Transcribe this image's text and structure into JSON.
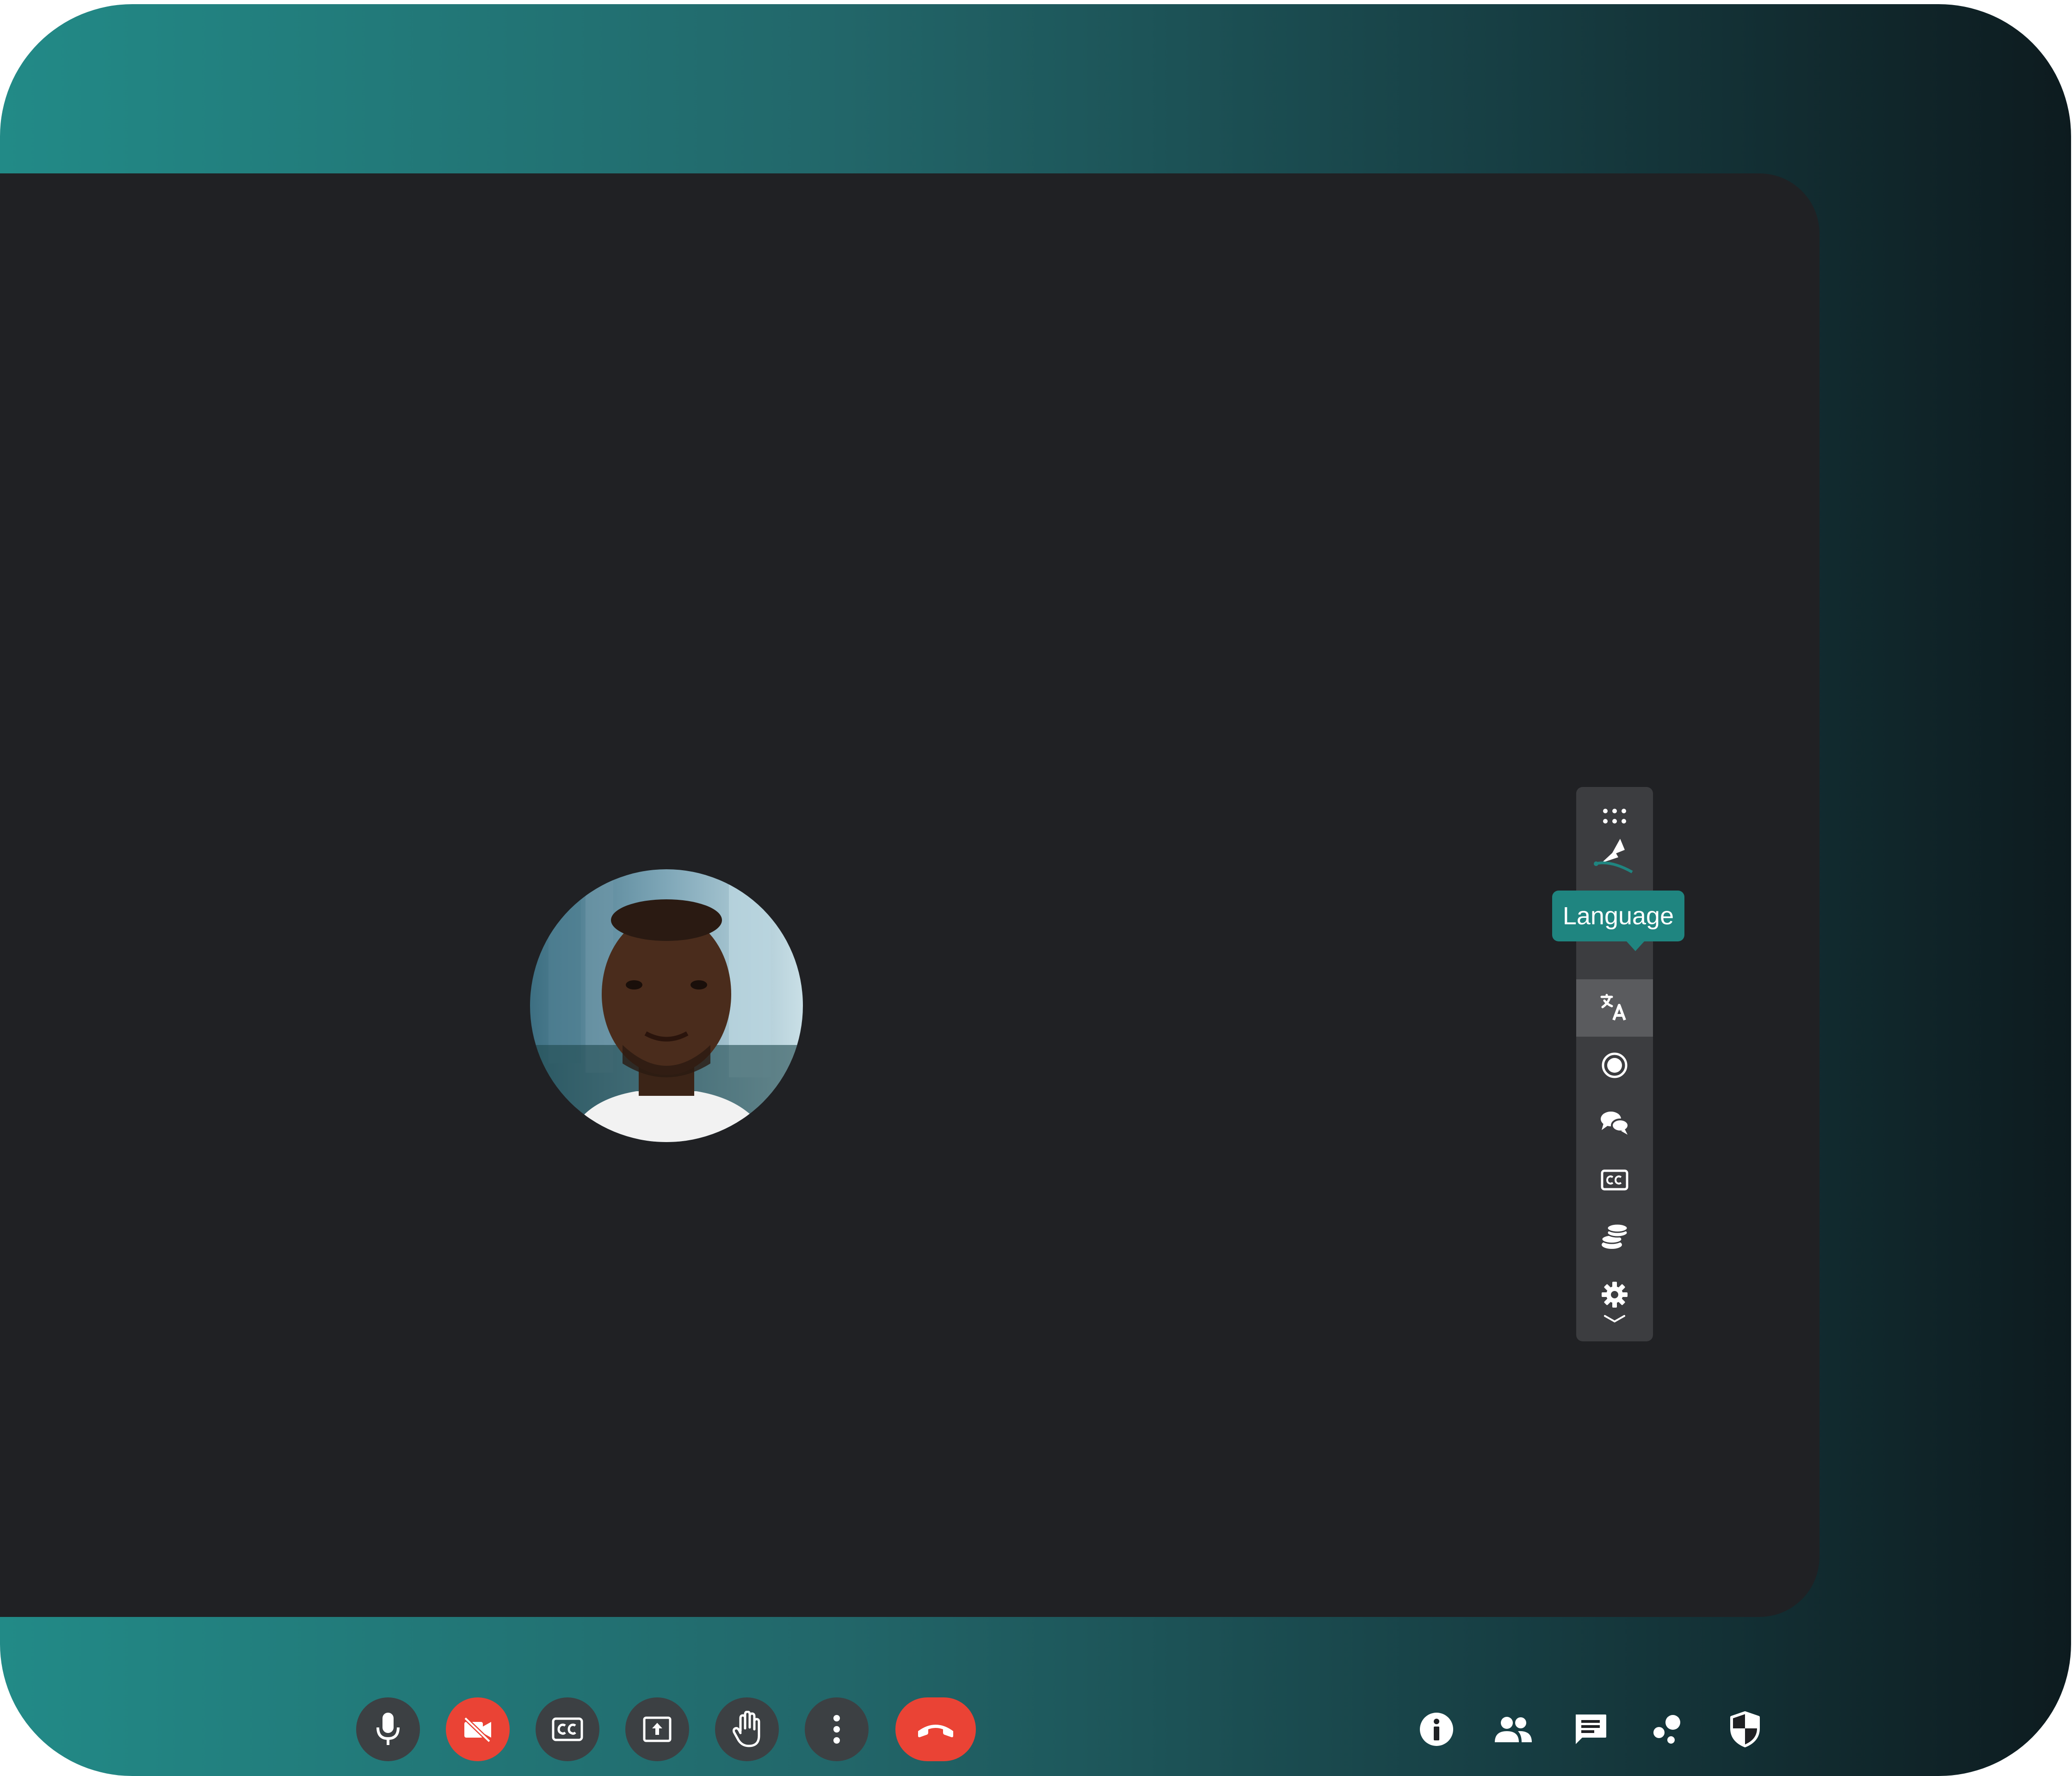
{
  "colors": {
    "stage_background": "#202124",
    "control_button": "#3c4043",
    "danger_red": "#ea4335",
    "tooltip_teal": "#1f8580",
    "panel_background": "#3c3d40",
    "panel_active": "#5a5b5e"
  },
  "participant": {
    "avatar": "participant-photo"
  },
  "side_panel": {
    "tooltip": "Language",
    "active_item": "language",
    "items": [
      {
        "id": "drag-handle",
        "icon": "drag-dots-icon"
      },
      {
        "id": "brand",
        "icon": "brand-logo-icon"
      },
      {
        "id": "annotate",
        "icon": "pen-icon"
      },
      {
        "id": "language",
        "icon": "translate-icon"
      },
      {
        "id": "record",
        "icon": "record-icon"
      },
      {
        "id": "chat",
        "icon": "chat-bubbles-icon"
      },
      {
        "id": "captions",
        "icon": "cc-icon"
      },
      {
        "id": "credits",
        "icon": "coins-icon"
      },
      {
        "id": "settings",
        "icon": "gear-icon"
      },
      {
        "id": "collapse",
        "icon": "chevron-down-icon"
      }
    ]
  },
  "bottom_controls": [
    {
      "id": "microphone",
      "icon": "mic-icon",
      "state": "on"
    },
    {
      "id": "camera",
      "icon": "camera-off-icon",
      "state": "off"
    },
    {
      "id": "captions",
      "icon": "cc-icon",
      "state": "off"
    },
    {
      "id": "present",
      "icon": "present-screen-icon",
      "state": "off"
    },
    {
      "id": "raise-hand",
      "icon": "hand-icon",
      "state": "off"
    },
    {
      "id": "more-options",
      "icon": "more-vert-icon",
      "state": "off"
    },
    {
      "id": "leave-call",
      "icon": "hang-up-icon",
      "state": "danger"
    }
  ],
  "right_controls": [
    {
      "id": "meeting-details",
      "icon": "info-icon"
    },
    {
      "id": "people",
      "icon": "people-icon"
    },
    {
      "id": "chat",
      "icon": "chat-icon"
    },
    {
      "id": "activities",
      "icon": "activities-icon"
    },
    {
      "id": "host-controls",
      "icon": "shield-icon"
    }
  ]
}
